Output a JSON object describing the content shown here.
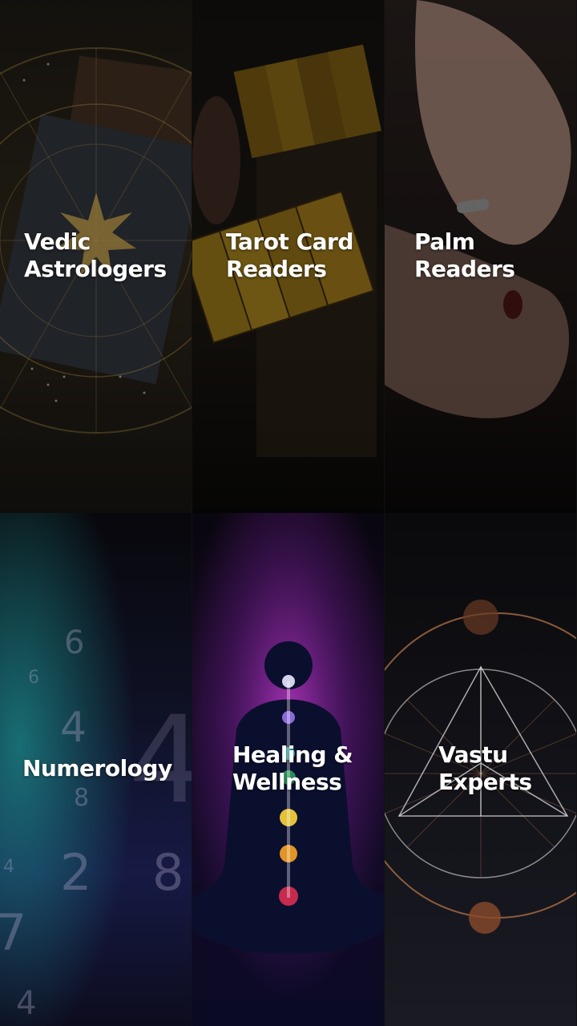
{
  "tiles": [
    {
      "label_lines": [
        "Vedic",
        "Astrologers"
      ]
    },
    {
      "label_lines": [
        "Tarot Card",
        "Readers"
      ]
    },
    {
      "label_lines": [
        "Palm",
        "Readers"
      ]
    },
    {
      "label_lines": [
        "Numerology"
      ]
    },
    {
      "label_lines": [
        "Healing &",
        "Wellness"
      ]
    },
    {
      "label_lines": [
        "Vastu",
        "Experts"
      ]
    }
  ],
  "numerology_digits": [
    "6",
    "6",
    "4",
    "8",
    "2",
    "8",
    "4",
    "7",
    "4",
    "4"
  ],
  "colors": {
    "accent_gold": "#c9a14a",
    "chakra_purple": "#9b2fb0",
    "vastu_copper": "#c07a4a"
  }
}
